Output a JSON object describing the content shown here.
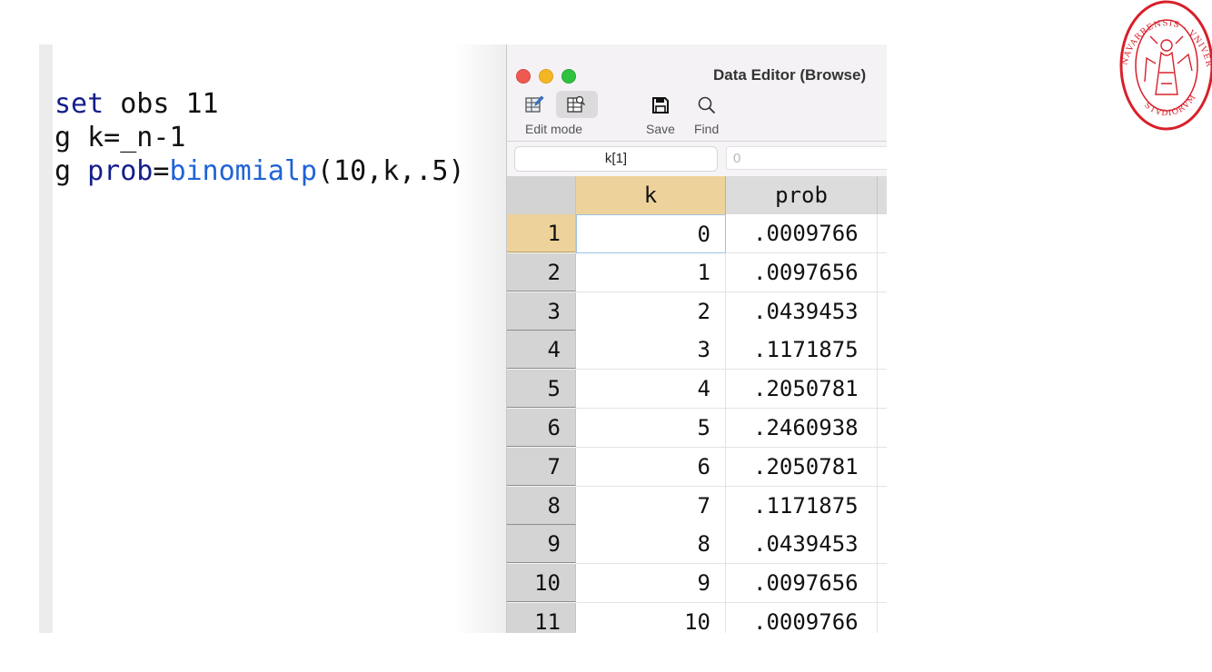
{
  "code": {
    "lines": [
      [
        {
          "text": "set",
          "cls": "kw-navy"
        },
        {
          "text": " obs 11",
          "cls": ""
        }
      ],
      [
        {
          "text": "g k=_n-1",
          "cls": ""
        }
      ],
      [
        {
          "text": "g ",
          "cls": ""
        },
        {
          "text": "prob",
          "cls": "kw-navy"
        },
        {
          "text": "=",
          "cls": ""
        },
        {
          "text": "binomialp",
          "cls": "kw-blue"
        },
        {
          "text": "(10,k,.5)",
          "cls": ""
        }
      ]
    ]
  },
  "window": {
    "title": "Data Editor (Browse)",
    "toolbar": {
      "edit_mode_label": "Edit mode",
      "save_label": "Save",
      "find_label": "Find"
    },
    "cell_reference": "k[1]",
    "cell_value_placeholder": "0"
  },
  "table": {
    "columns": [
      "k",
      "prob"
    ],
    "rows": [
      {
        "n": "1",
        "k": "0",
        "prob": ".0009766"
      },
      {
        "n": "2",
        "k": "1",
        "prob": ".0097656"
      },
      {
        "n": "3",
        "k": "2",
        "prob": ".0439453"
      },
      {
        "n": "4",
        "k": "3",
        "prob": ".1171875"
      },
      {
        "n": "5",
        "k": "4",
        "prob": ".2050781"
      },
      {
        "n": "6",
        "k": "5",
        "prob": ".2460938"
      },
      {
        "n": "7",
        "k": "6",
        "prob": ".2050781"
      },
      {
        "n": "8",
        "k": "7",
        "prob": ".1171875"
      },
      {
        "n": "9",
        "k": "8",
        "prob": ".0439453"
      },
      {
        "n": "10",
        "k": "9",
        "prob": ".0097656"
      },
      {
        "n": "11",
        "k": "10",
        "prob": ".0009766"
      }
    ]
  },
  "logo": {
    "text": "NAVARRENSIS · UNIVERSITAS · STUDIORUM",
    "color": "#d8202a"
  },
  "colors": {
    "header_selected": "#edd39b",
    "code_keyword": "#141e8a",
    "code_function": "#1f63d6"
  }
}
